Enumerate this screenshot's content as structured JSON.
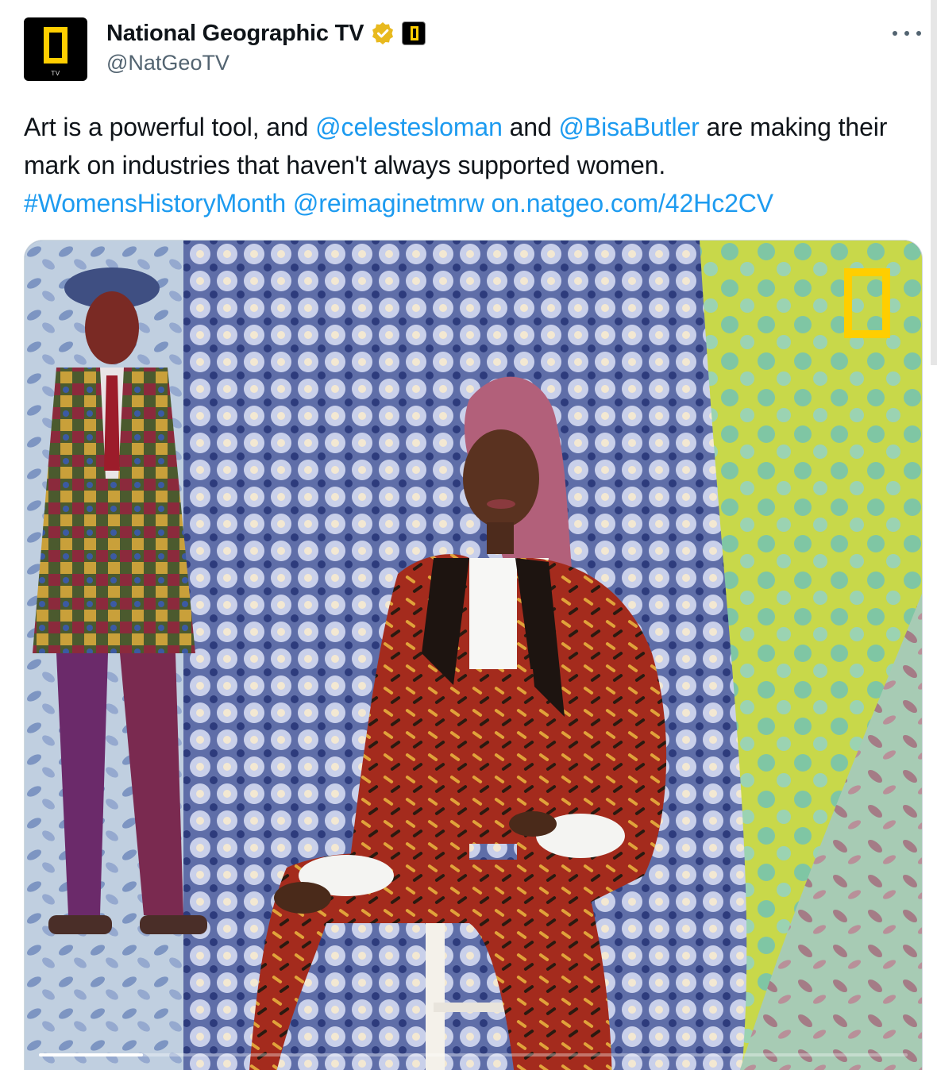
{
  "account": {
    "display_name": "National Geographic TV",
    "handle": "@NatGeoTV",
    "avatar_label": "TV",
    "verified_color": "#e8b91e",
    "affiliate_color": "#ffce00"
  },
  "tweet": {
    "segments": [
      {
        "text": "Art is a powerful tool, and ",
        "link": false
      },
      {
        "text": "@celestesloman",
        "link": true
      },
      {
        "text": " and ",
        "link": false
      },
      {
        "text": "@BisaButler",
        "link": true
      },
      {
        "text": " are making their mark on industries that haven't always supported women.",
        "link": false
      },
      {
        "text": "\n",
        "link": false
      },
      {
        "text": "#WomensHistoryMonth",
        "link": true
      },
      {
        "text": " ",
        "link": false
      },
      {
        "text": "@reimaginetmrw",
        "link": true
      },
      {
        "text": " ",
        "link": false
      },
      {
        "text": "on.natgeo.com/42Hc2CV",
        "link": true
      }
    ],
    "link_color": "#1d9bf0"
  },
  "media": {
    "type": "video",
    "progress": 0.12,
    "watermark": "natgeo-frame-logo"
  },
  "icons": {
    "more": "more-options-icon",
    "verified": "verified-badge-icon",
    "affiliate": "affiliate-badge-icon"
  }
}
